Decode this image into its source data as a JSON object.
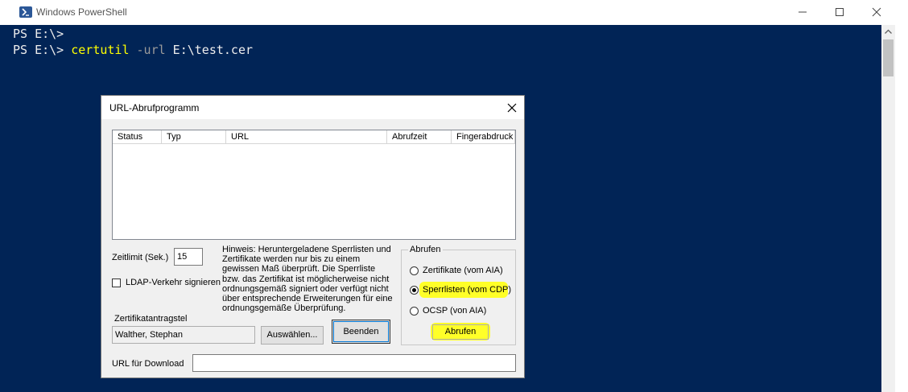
{
  "window": {
    "title": "Windows PowerShell",
    "console_lines": [
      {
        "prompt": "PS E:\\> ",
        "command": "",
        "flag": "",
        "arg": ""
      },
      {
        "prompt": "PS E:\\> ",
        "command": "certutil",
        "flag": " -url",
        "arg": " E:\\test.cer"
      }
    ]
  },
  "dialog": {
    "title": "URL-Abrufprogramm",
    "columns": [
      "Status",
      "Typ",
      "URL",
      "Abrufzeit",
      "Fingerabdruck"
    ],
    "timeout_label": "Zeitlimit (Sek.)",
    "timeout_value": "15",
    "ldap_label": "LDAP-Verkehr signieren",
    "hint": "Hinweis: Heruntergeladene Sperrlisten und Zertifikate werden nur bis zu einem gewissen Maß überprüft. Die Sperrliste bzw. das Zertifikat ist möglicherweise nicht ordnungsgemäß signiert oder verfügt nicht über entsprechende Erweiterungen für eine ordnungsgemäße Überprüfung.",
    "requester_label": "Zertifikatantragstel",
    "requester_value": "Walther, Stephan",
    "select_button": "Auswählen...",
    "finish_button": "Beenden",
    "group_title": "Abrufen",
    "radio_certs": "Zertifikate (vom AIA)",
    "radio_crl": "Sperrlisten (vom CDP)",
    "radio_ocsp": "OCSP (von AIA)",
    "retrieve_button": "Abrufen",
    "download_label": "URL für Download",
    "download_value": ""
  },
  "colors": {
    "console_bg": "#012456",
    "console_text": "#ededed",
    "command": "#ffff00",
    "param": "#9a9a9a",
    "highlight": "#ffff28"
  }
}
